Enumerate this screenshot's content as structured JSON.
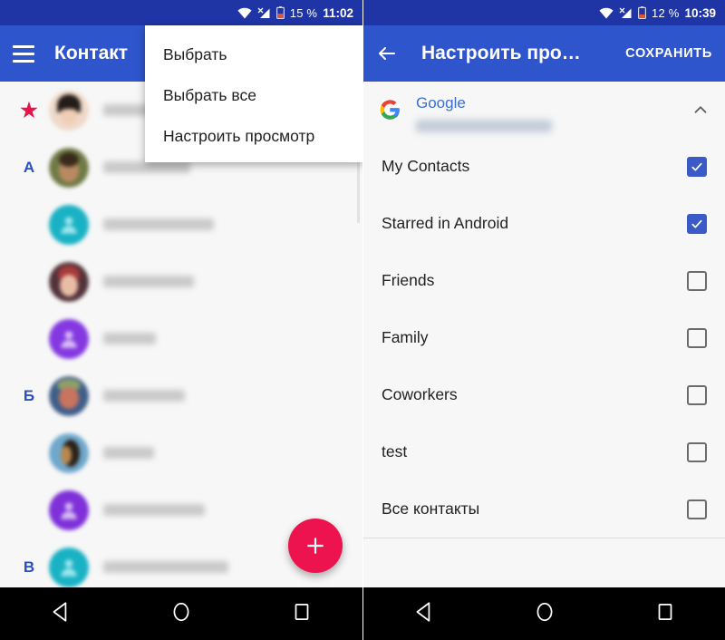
{
  "left": {
    "status": {
      "battery": "15 %",
      "time": "11:02",
      "wifi_icon": "wifi-icon",
      "signal_icon": "signal-no-service-icon",
      "battery_icon": "battery-low-icon"
    },
    "appbar": {
      "menu_icon": "hamburger-menu-icon",
      "title": "Контакт"
    },
    "menu": {
      "items": [
        {
          "label": "Выбрать"
        },
        {
          "label": "Выбрать все"
        },
        {
          "label": "Настроить просмотр"
        }
      ]
    },
    "fab": {
      "icon": "plus-icon",
      "label": "Добавить контакт"
    },
    "contacts": [
      {
        "index": "★",
        "index_type": "star",
        "avatar_type": "photo",
        "avatar_color": "#efd9c8",
        "name_width": 52
      },
      {
        "index": "А",
        "index_type": "letter",
        "avatar_type": "photo",
        "avatar_color": "#7a6a48",
        "name_width": 96
      },
      {
        "index": "",
        "index_type": "none",
        "avatar_type": "generic",
        "avatar_color": "#19b2c4",
        "name_width": 122
      },
      {
        "index": "",
        "index_type": "none",
        "avatar_type": "photo",
        "avatar_color": "#a8566a",
        "name_width": 100
      },
      {
        "index": "",
        "index_type": "none",
        "avatar_type": "generic",
        "avatar_color": "#8439e0",
        "name_width": 58
      },
      {
        "index": "Б",
        "index_type": "letter",
        "avatar_type": "photo",
        "avatar_color": "#8a6b55",
        "name_width": 90
      },
      {
        "index": "",
        "index_type": "none",
        "avatar_type": "photo",
        "avatar_color": "#4f7fa8",
        "name_width": 56
      },
      {
        "index": "",
        "index_type": "none",
        "avatar_type": "generic",
        "avatar_color": "#7f30d8",
        "name_width": 112
      },
      {
        "index": "В",
        "index_type": "letter",
        "avatar_type": "generic",
        "avatar_color": "#19b2c4",
        "name_width": 138
      }
    ]
  },
  "right": {
    "status": {
      "battery": "12 %",
      "time": "10:39",
      "wifi_icon": "wifi-icon",
      "signal_icon": "signal-no-service-icon",
      "battery_icon": "battery-low-icon"
    },
    "appbar": {
      "back_icon": "back-arrow-icon",
      "title": "Настроить про…",
      "save_label": "СОХРАНИТЬ"
    },
    "account": {
      "logo_icon": "google-logo-icon",
      "name": "Google",
      "email": "",
      "collapse_icon": "chevron-up-icon"
    },
    "groups": [
      {
        "label": "My Contacts",
        "checked": true
      },
      {
        "label": "Starred in Android",
        "checked": true
      },
      {
        "label": "Friends",
        "checked": false
      },
      {
        "label": "Family",
        "checked": false
      },
      {
        "label": "Coworkers",
        "checked": false
      },
      {
        "label": "test",
        "checked": false
      },
      {
        "label": "Все контакты",
        "checked": false
      }
    ]
  },
  "navbar": {
    "back_icon": "nav-back-icon",
    "home_icon": "nav-home-icon",
    "recents_icon": "nav-recents-icon"
  },
  "colors": {
    "statusbar": "#1f35a6",
    "appbar": "#2f55cc",
    "accent_pink": "#ec134f",
    "index_blue": "#2c4fc4",
    "checkbox_blue": "#3a5bc7",
    "account_blue": "#3b6fd4"
  }
}
